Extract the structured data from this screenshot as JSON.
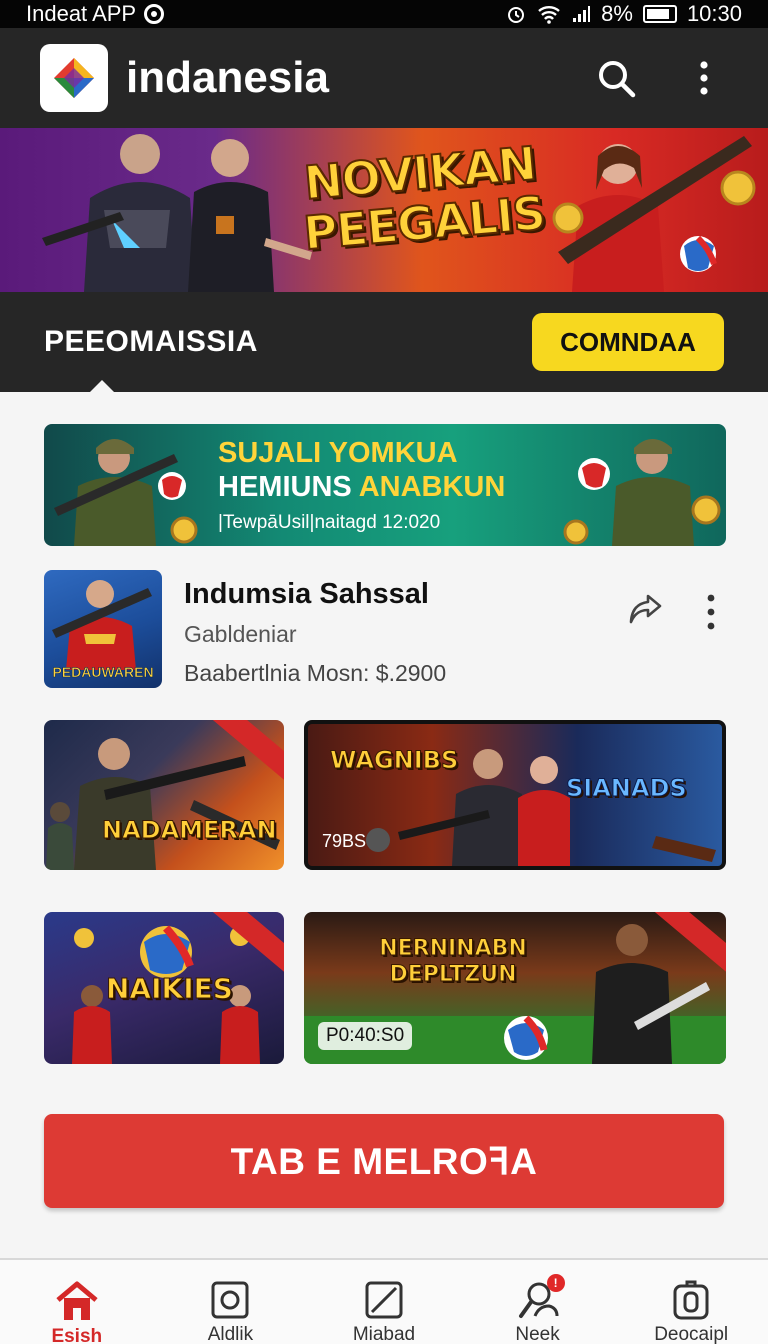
{
  "status_bar": {
    "app_name": "Indeat APP",
    "battery": "8%",
    "time": "10:30"
  },
  "app_bar": {
    "title": "indanesia"
  },
  "hero": {
    "title_line1": "NOVIKAN",
    "title_line2": "PEEGALIS"
  },
  "section": {
    "title": "PEEOMAISSIA",
    "button_label": "COMNDAA"
  },
  "promo": {
    "line1": "SUJALI YOMKUA",
    "line2_a": "HEMIUNS",
    "line2_b": "ANABKUN",
    "line3": "|TewpāUsil|naitagd  12:020"
  },
  "item": {
    "thumb_label": "PEDAUWAREN",
    "title": "Indumsia Sahssal",
    "subtitle": "Gabldeniar",
    "price": "Baabertlnia Mosn: $.2900"
  },
  "cards": [
    {
      "title": "NADAMERAN"
    },
    {
      "title": "WAGNIBS",
      "title2": "SIANADS",
      "time": "79BS"
    },
    {
      "title": "NAIKIES"
    },
    {
      "title": "NERNINABN DEPLTZUN",
      "time": "P0:40:S0"
    }
  ],
  "cta": {
    "label": "TAB E MELROꟻA"
  },
  "bottom_nav": [
    {
      "label": "Esish",
      "icon": "home-icon",
      "active": true
    },
    {
      "label": "Aldlik",
      "icon": "square-icon"
    },
    {
      "label": "Miabad",
      "icon": "slash-box-icon"
    },
    {
      "label": "Neek",
      "icon": "search-user-icon",
      "badge": "!"
    },
    {
      "label": "Deocaipl",
      "icon": "bag-icon"
    }
  ],
  "colors": {
    "accent_yellow": "#f7d81f",
    "accent_red": "#dd3a34",
    "appbar": "#262626"
  }
}
